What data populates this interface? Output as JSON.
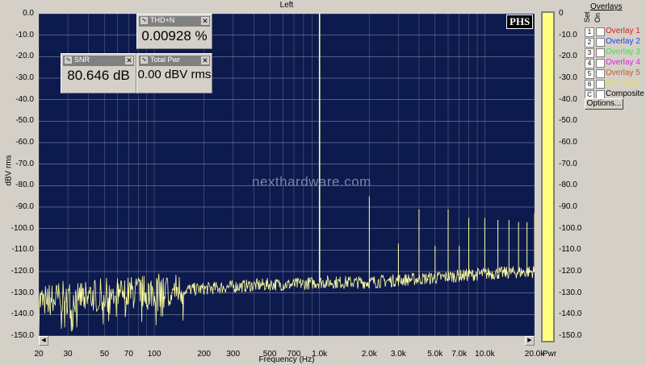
{
  "window": {
    "title": "Left"
  },
  "axes": {
    "ylabel": "dBV rms",
    "xlabel": "Frequency (Hz)",
    "power_label": "Pwr",
    "y_ticks": [
      "0.0",
      "-10.0",
      "-20.0",
      "-30.0",
      "-40.0",
      "-50.0",
      "-60.0",
      "-70.0",
      "-80.0",
      "-90.0",
      "-100.0",
      "-110.0",
      "-120.0",
      "-130.0",
      "-140.0",
      "-150.0"
    ],
    "right_ticks": [
      "0",
      "-10.0",
      "-20.0",
      "-30.0",
      "-40.0",
      "-50.0",
      "-60.0",
      "-70.0",
      "-80.0",
      "-90.0",
      "-100.0",
      "-110.0",
      "-120.0",
      "-130.0",
      "-140.0",
      "-150.0"
    ],
    "x_ticks": [
      {
        "label": "20",
        "f": 20
      },
      {
        "label": "30",
        "f": 30
      },
      {
        "label": "50",
        "f": 50
      },
      {
        "label": "70",
        "f": 70
      },
      {
        "label": "100",
        "f": 100
      },
      {
        "label": "200",
        "f": 200
      },
      {
        "label": "300",
        "f": 300
      },
      {
        "label": "500",
        "f": 500
      },
      {
        "label": "700",
        "f": 700
      },
      {
        "label": "1.0k",
        "f": 1000
      },
      {
        "label": "2.0k",
        "f": 2000
      },
      {
        "label": "3.0k",
        "f": 3000
      },
      {
        "label": "5.0k",
        "f": 5000
      },
      {
        "label": "7.0k",
        "f": 7000
      },
      {
        "label": "10.0k",
        "f": 10000
      },
      {
        "label": "20.0k",
        "f": 20000
      }
    ]
  },
  "meters": {
    "thdn": {
      "title": "THD+N",
      "value": "0.00928 %"
    },
    "snr": {
      "title": "SNR",
      "value": "80.646 dB"
    },
    "power": {
      "title": "Total Pwr",
      "value": "0.00 dBV rms"
    }
  },
  "logo": "PHS",
  "watermark": "nexthardware.com",
  "overlays": {
    "title": "Overlays",
    "set_label": "Set",
    "on_label": "On",
    "items": [
      {
        "num": "1",
        "label": "Overlay 1",
        "color": "#e02020"
      },
      {
        "num": "2",
        "label": "Overlay 2",
        "color": "#2040e0"
      },
      {
        "num": "3",
        "label": "Overlay 3",
        "color": "#40e040"
      },
      {
        "num": "4",
        "label": "Overlay 4",
        "color": "#e020e0"
      },
      {
        "num": "5",
        "label": "Overlay 5",
        "color": "#c06020"
      },
      {
        "num": "6",
        "label": "Overlay 6",
        "color": "#e0e060"
      },
      {
        "num": "C",
        "label": "Composite",
        "color": "#000000"
      }
    ],
    "options_label": "Options..."
  },
  "chart_data": {
    "type": "line",
    "title": "Left",
    "xlabel": "Frequency (Hz)",
    "ylabel": "dBV rms",
    "x_scale": "log",
    "xlim": [
      20,
      20000
    ],
    "ylim": [
      -150,
      0
    ],
    "grid": true,
    "colors": {
      "background": "#0d1a4d",
      "grid": "#ffffff",
      "trace": "#ffffa0"
    },
    "fundamental": {
      "f": 1000,
      "level": 0
    },
    "peaks": [
      {
        "f": 1000,
        "level": 0.0
      },
      {
        "f": 2000,
        "level": -85.0
      },
      {
        "f": 3000,
        "level": -107.0
      },
      {
        "f": 4000,
        "level": -91.0
      },
      {
        "f": 5000,
        "level": -108.0
      },
      {
        "f": 6000,
        "level": -91.0
      },
      {
        "f": 7000,
        "level": -108.0
      },
      {
        "f": 8000,
        "level": -95.0
      },
      {
        "f": 10000,
        "level": -95.0
      },
      {
        "f": 12000,
        "level": -96.0
      },
      {
        "f": 14000,
        "level": -96.0
      },
      {
        "f": 16000,
        "level": -97.0
      },
      {
        "f": 18000,
        "level": -97.0
      },
      {
        "f": 20000,
        "level": -93.0
      }
    ],
    "noise_floor": [
      {
        "f": 20,
        "level": -134
      },
      {
        "f": 30,
        "level": -132
      },
      {
        "f": 50,
        "level": -131
      },
      {
        "f": 70,
        "level": -130
      },
      {
        "f": 100,
        "level": -129
      },
      {
        "f": 200,
        "level": -128
      },
      {
        "f": 300,
        "level": -127
      },
      {
        "f": 500,
        "level": -126
      },
      {
        "f": 700,
        "level": -126
      },
      {
        "f": 1000,
        "level": -125
      },
      {
        "f": 2000,
        "level": -125
      },
      {
        "f": 3000,
        "level": -124
      },
      {
        "f": 5000,
        "level": -123
      },
      {
        "f": 7000,
        "level": -122
      },
      {
        "f": 10000,
        "level": -121
      },
      {
        "f": 20000,
        "level": -120
      }
    ]
  }
}
